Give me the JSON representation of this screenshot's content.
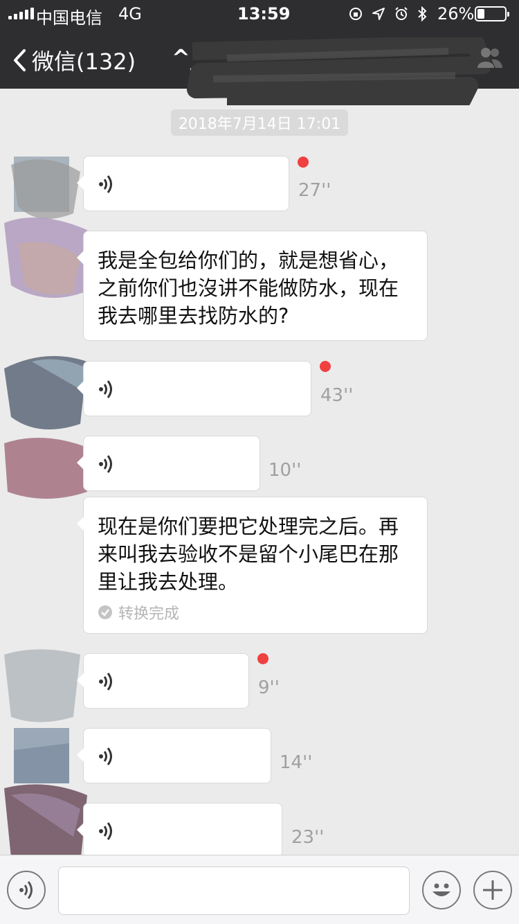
{
  "status_bar": {
    "carrier": "中国电信",
    "network": "4G",
    "time": "13:59",
    "battery_percent": "26%",
    "battery_level": 0.26
  },
  "nav": {
    "back_label": "微信(132)",
    "title": "^_^"
  },
  "chat": {
    "timestamp": "2018年7月14日 17:01",
    "messages": [
      {
        "type": "voice",
        "duration": "27''",
        "unread": true
      },
      {
        "type": "text",
        "text": "我是全包给你们的，就是想省心，之前你们也沒讲不能做防水，现在我去哪里去找防水的?"
      },
      {
        "type": "voice",
        "duration": "43''",
        "unread": true
      },
      {
        "type": "voice",
        "duration": "10''",
        "unread": false
      },
      {
        "type": "converted",
        "text": "现在是你们要把它处理完之后。再来叫我去验收不是留个小尾巴在那里让我去处理。",
        "status": "转换完成"
      },
      {
        "type": "voice",
        "duration": "9''",
        "unread": true
      },
      {
        "type": "voice",
        "duration": "14''",
        "unread": false
      },
      {
        "type": "voice",
        "duration": "23''",
        "unread": false
      }
    ]
  },
  "input": {
    "placeholder": ""
  },
  "icons": {
    "back": "chevron-left-icon",
    "contact": "person-icon",
    "voice": "voice-wave-icon",
    "emoji": "emoji-icon",
    "add": "plus-icon",
    "check": "check-circle-icon"
  },
  "colors": {
    "nav_bg": "#2e2e31",
    "chat_bg": "#ebebeb",
    "unread_dot": "#f04040",
    "duration_text": "#a0a0a0"
  }
}
